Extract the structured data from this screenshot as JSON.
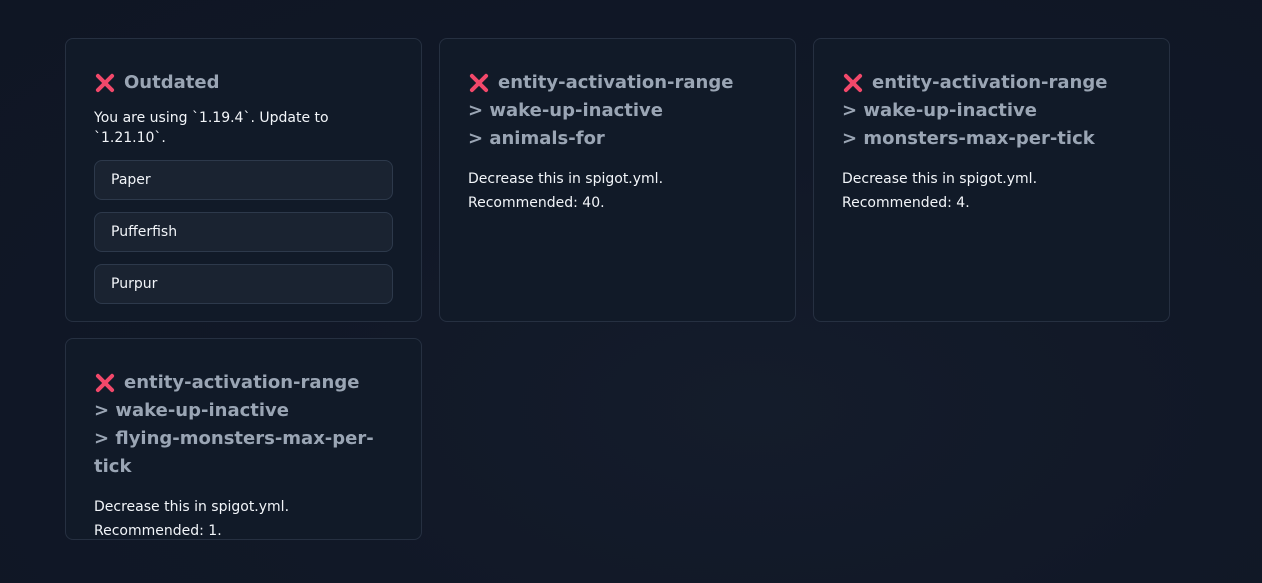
{
  "cards": [
    {
      "title": "Outdated",
      "text": "You are using `1.19.4`. Update to `1.21.10`.",
      "options": [
        "Paper",
        "Pufferfish",
        "Purpur"
      ]
    },
    {
      "title_lines": [
        "entity-activation-range",
        "> wake-up-inactive",
        "> animals-for"
      ],
      "desc_lines": [
        "Decrease this in spigot.yml.",
        "Recommended: 40."
      ]
    },
    {
      "title_lines": [
        "entity-activation-range",
        "> wake-up-inactive",
        "> monsters-max-per-tick"
      ],
      "desc_lines": [
        "Decrease this in spigot.yml.",
        "Recommended: 4."
      ]
    },
    {
      "title_lines": [
        "entity-activation-range",
        "> wake-up-inactive",
        "> flying-monsters-max-per-tick"
      ],
      "desc_lines": [
        "Decrease this in spigot.yml.",
        "Recommended: 1."
      ]
    }
  ],
  "icon": "close-icon",
  "colors": {
    "accent_red": "#f2486a",
    "background": "#111827",
    "card": "#111a28"
  }
}
